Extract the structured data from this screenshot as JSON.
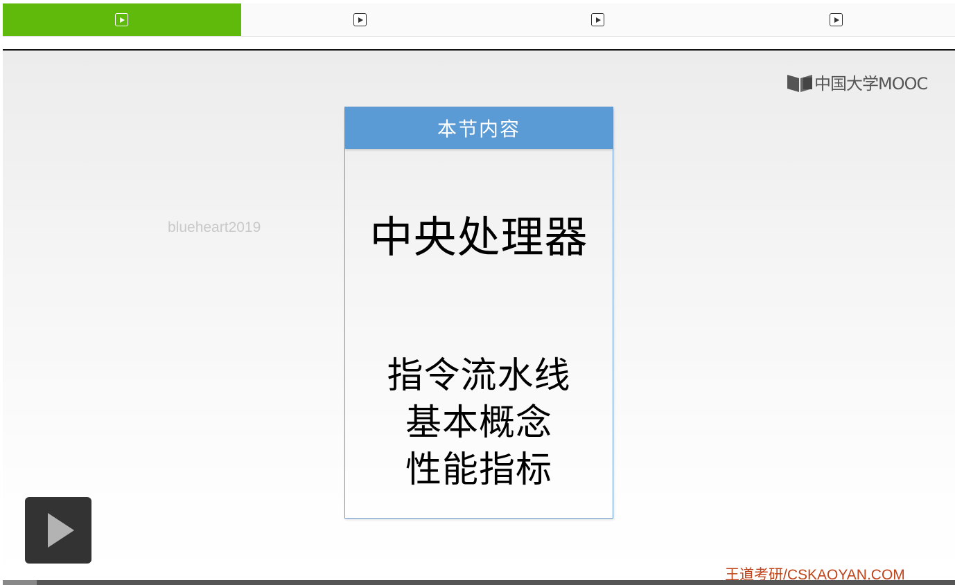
{
  "tabs": [
    {
      "icon": "play-square-icon",
      "active": true
    },
    {
      "icon": "play-square-icon",
      "active": false
    },
    {
      "icon": "play-square-icon",
      "active": false
    },
    {
      "icon": "play-square-icon",
      "active": false
    }
  ],
  "colors": {
    "active_tab": "#5fba0c",
    "card_header": "#5b9bd5",
    "footer_brand": "#c0441a"
  },
  "slide": {
    "logo_text": "中国大学MOOC",
    "watermark": "blueheart2019",
    "card": {
      "header": "本节内容",
      "title": "中央处理器",
      "lines": [
        "指令流水线",
        "基本概念",
        "性能指标"
      ]
    },
    "footer_brand": "王道考研/CSKAOYAN.COM"
  },
  "player": {
    "play_icon": "play-icon",
    "progress": 0.036
  }
}
